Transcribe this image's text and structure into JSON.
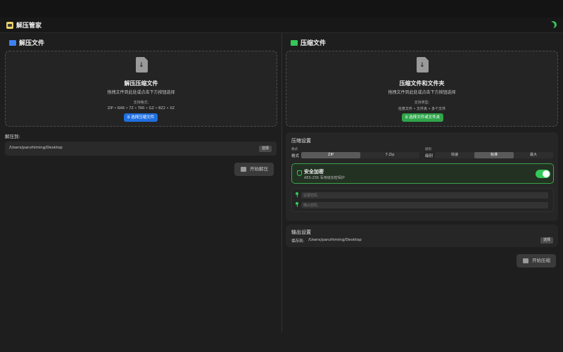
{
  "app": {
    "title": "解压管家",
    "theme_icon": "moon-icon"
  },
  "left": {
    "header": "解压文件",
    "header_icon": "tray-download-icon",
    "drop": {
      "title": "解压压缩文件",
      "subtitle": "拖拽文件到此处或点击下方按钮选择",
      "formats_label": "支持格式:",
      "formats": "ZIP • RAR • 7Z • TAR • GZ • BZ2 • XZ",
      "button": "选择压缩文件"
    },
    "extract_to_label": "解压到:",
    "path": "/Users/panzhiming/Desktop",
    "choose_button": "选择",
    "start_button": "开始解压"
  },
  "right": {
    "header": "压缩文件",
    "header_icon": "archive-box-icon",
    "drop": {
      "title": "压缩文件和文件夹",
      "subtitle": "拖拽文件到此处或点击下方按钮选择",
      "formats_label": "支持类型:",
      "formats": "任意文件 • 文件夹 • 多个文件",
      "button": "选择文件或文件夹"
    },
    "settings": {
      "title": "压缩设置",
      "format_caption": "格式",
      "format_label": "格式",
      "formats": [
        "ZIP",
        "7-Zip"
      ],
      "format_selected": 0,
      "level_caption": "级别",
      "level_label": "级别",
      "levels": [
        "快速",
        "标准",
        "最大"
      ],
      "level_selected": 1
    },
    "secure": {
      "title": "安全加密",
      "subtitle": "AES-256 军用级加密保护",
      "enabled": true
    },
    "password_placeholder": "设置密码",
    "confirm_placeholder": "确认密码",
    "output": {
      "title": "输出设置",
      "save_label": "保存到:",
      "path": "/Users/panzhiming/Desktop",
      "choose_button": "选择"
    },
    "start_button": "开始压缩"
  },
  "colors": {
    "accent_blue": "#1f6fe0",
    "accent_green": "#2fa54a",
    "toggle_on": "#34c759"
  }
}
